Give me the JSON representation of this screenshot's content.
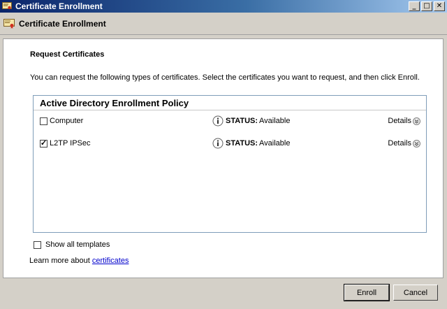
{
  "window": {
    "title": "Certificate Enrollment",
    "controls": [
      "_",
      "□",
      "✕"
    ]
  },
  "header": {
    "title": "Certificate Enrollment"
  },
  "main": {
    "section_title": "Request Certificates",
    "intro": "You can request the following types of certificates. Select the certificates you want to request, and then click Enroll.",
    "policy_title": "Active Directory Enrollment Policy",
    "status_label": "STATUS:",
    "details_label": "Details",
    "certificates": [
      {
        "name": "Computer",
        "checked": false,
        "status": "Available"
      },
      {
        "name": "L2TP IPSec",
        "checked": true,
        "status": "Available"
      }
    ],
    "show_all_label": "Show all templates",
    "learn_more_prefix": "Learn more about ",
    "learn_more_link": "certificates"
  },
  "footer": {
    "enroll_label": "Enroll",
    "cancel_label": "Cancel"
  }
}
